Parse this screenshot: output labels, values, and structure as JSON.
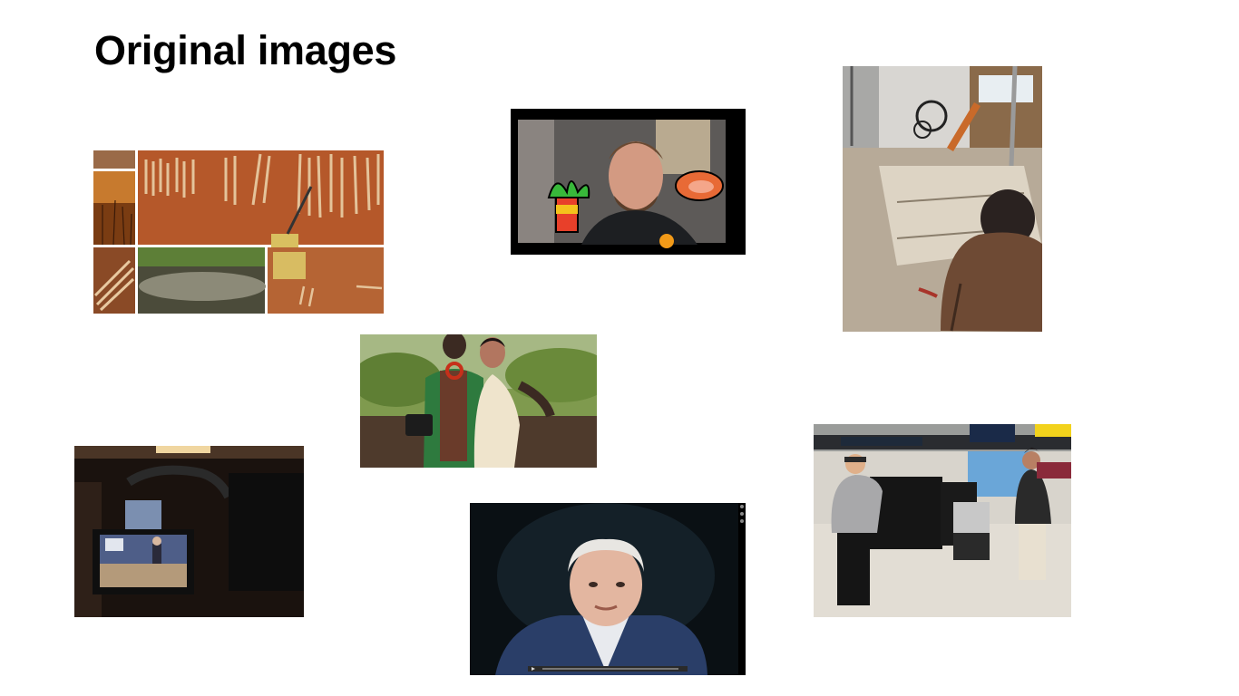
{
  "slide": {
    "title": "Original images"
  },
  "images": [
    {
      "name": "logging-collage"
    },
    {
      "name": "vlogger-with-stickers"
    },
    {
      "name": "warehouse-woman"
    },
    {
      "name": "field-portrait"
    },
    {
      "name": "camera-monitor"
    },
    {
      "name": "documentary-presenter"
    },
    {
      "name": "airport-crew"
    }
  ]
}
